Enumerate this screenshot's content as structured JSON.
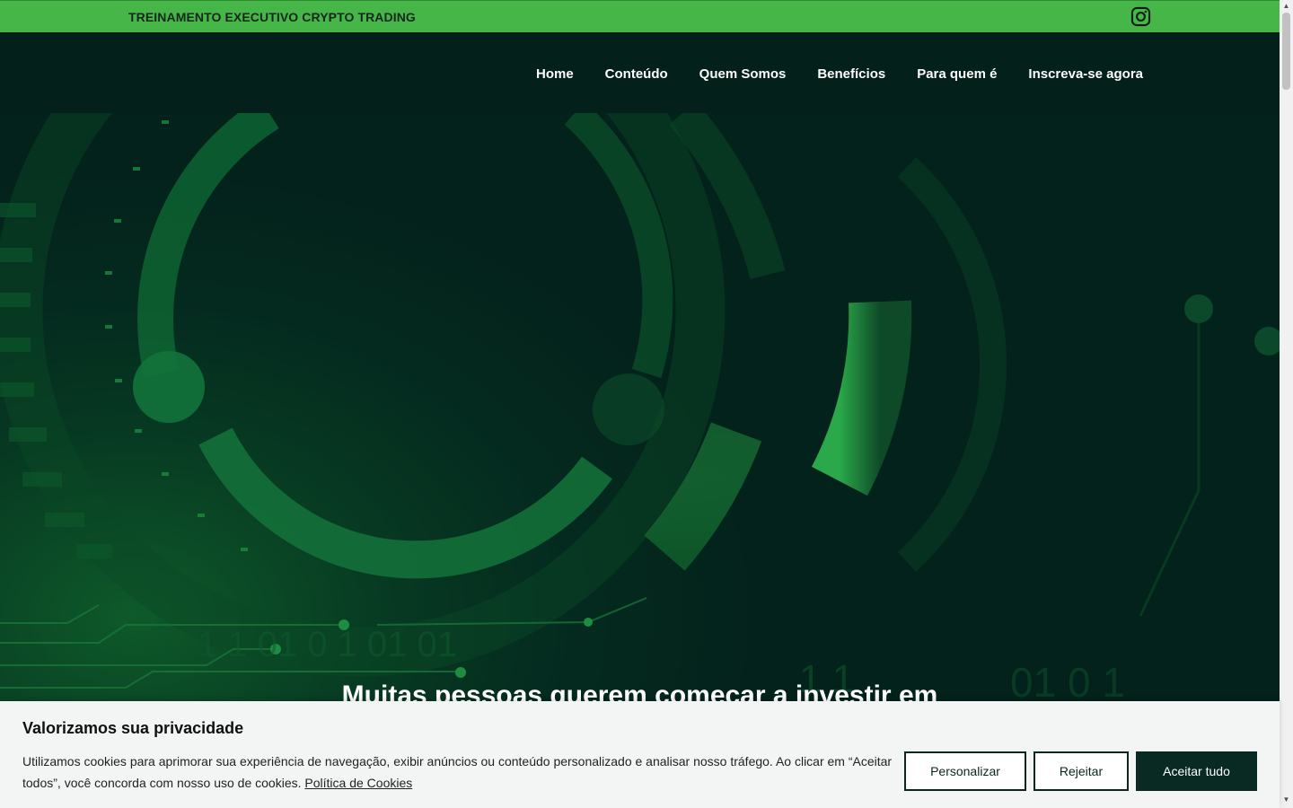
{
  "topbar": {
    "title": "TREINAMENTO EXECUTIVO CRYPTO TRADING",
    "social_icon": "instagram-icon",
    "bg_color": "#47b649"
  },
  "nav": {
    "items": [
      {
        "label": "Home"
      },
      {
        "label": "Conteúdo"
      },
      {
        "label": "Quem Somos"
      },
      {
        "label": "Benefícios"
      },
      {
        "label": "Para quem é"
      },
      {
        "label": "Inscreva-se agora"
      }
    ]
  },
  "hero": {
    "heading": "Muitas pessoas querem começar a investir em",
    "binary_left": "1 1     01  0 1   01  01",
    "binary_right": "1 1",
    "binary_far": "01  0  1"
  },
  "cookie_banner": {
    "title": "Valorizamos sua privacidade",
    "text": "Utilizamos cookies para aprimorar sua experiência de navegação, exibir anúncios ou conteúdo personalizado e analisar nosso tráfego. Ao clicar em “Aceitar todos”, você concorda com nosso uso de cookies.",
    "policy_link": "Política de Cookies",
    "buttons": {
      "customize": "Personalizar",
      "reject": "Rejeitar",
      "accept_all": "Aceitar tudo"
    }
  },
  "colors": {
    "brand_green": "#47b649",
    "dark_bg": "#03221b",
    "button_dark": "#082a22"
  }
}
